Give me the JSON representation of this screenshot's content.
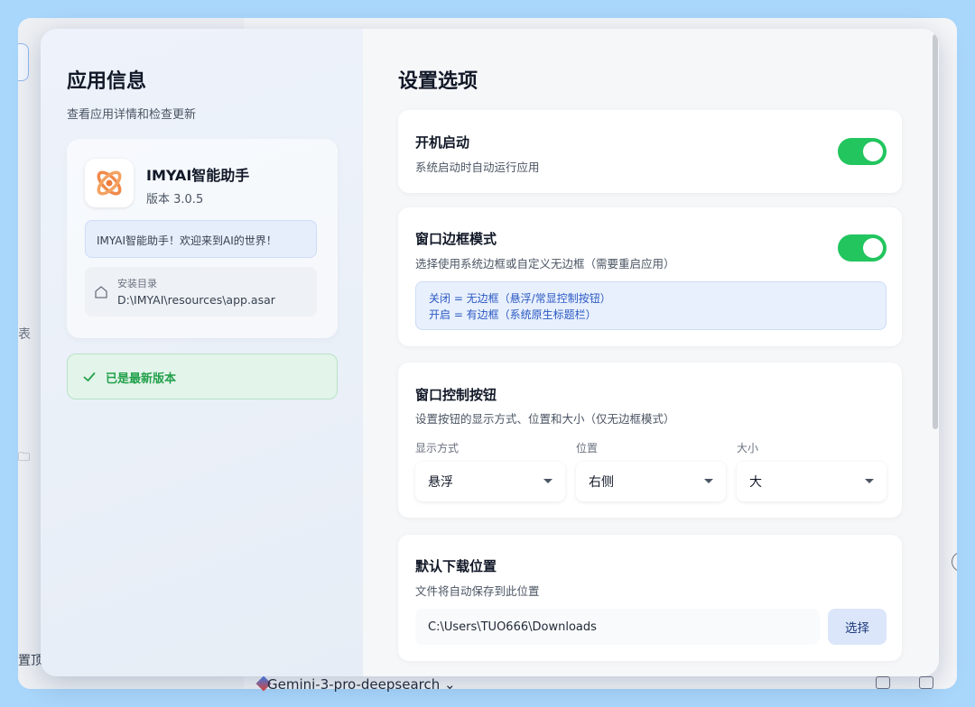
{
  "background": {
    "sidebar_fragment_1": "表",
    "sidebar_fragment_2": "置顶",
    "model_selector": "Gemini-3-pro-deepsearch"
  },
  "about": {
    "title": "应用信息",
    "subtitle": "查看应用详情和检查更新",
    "app_name": "IMYAI智能助手",
    "version": "版本 3.0.5",
    "welcome": "IMYAI智能助手！欢迎来到AI的世界！",
    "install_label": "安装目录",
    "install_path": "D:\\IMYAI\\resources\\app.asar",
    "update_status": "已是最新版本"
  },
  "settings": {
    "title": "设置选项",
    "autostart": {
      "title": "开机启动",
      "desc": "系统启动时自动运行应用",
      "enabled": true
    },
    "frame_mode": {
      "title": "窗口边框模式",
      "desc": "选择使用系统边框或自定义无边框（需要重启应用）",
      "enabled": true,
      "info_line1": "关闭 = 无边框（悬浮/常显控制按钮）",
      "info_line2": "开启 = 有边框（系统原生标题栏）"
    },
    "window_controls": {
      "title": "窗口控制按钮",
      "desc": "设置按钮的显示方式、位置和大小（仅无边框模式）",
      "display_label": "显示方式",
      "display_value": "悬浮",
      "position_label": "位置",
      "position_value": "右侧",
      "size_label": "大小",
      "size_value": "大"
    },
    "download": {
      "title": "默认下载位置",
      "desc": "文件将自动保存到此位置",
      "path": "C:\\Users\\TUO666\\Downloads",
      "choose_label": "选择"
    }
  },
  "colors": {
    "accent_green": "#22c55e",
    "info_blue": "#2b59c3",
    "success_text": "#22a04b"
  }
}
